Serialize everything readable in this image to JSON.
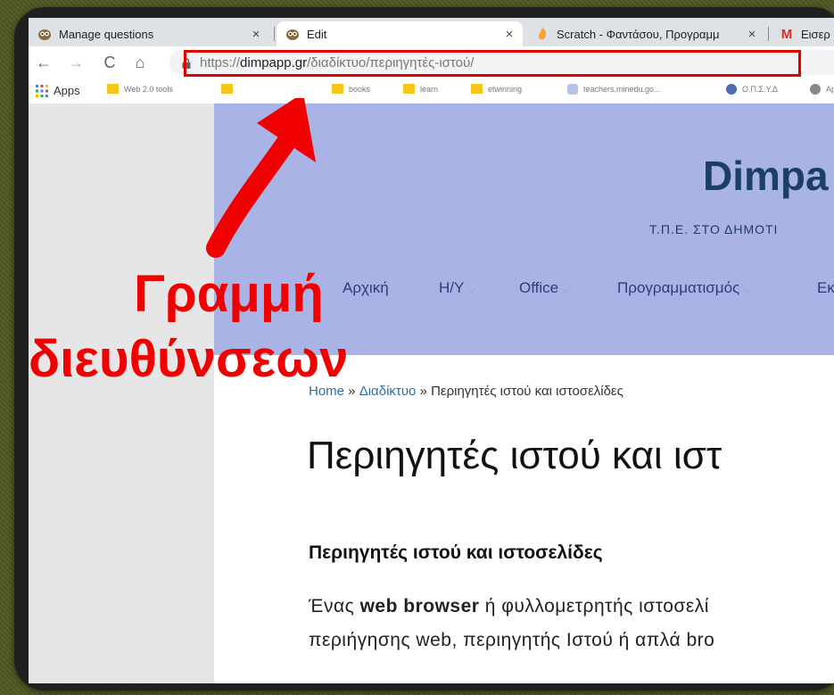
{
  "tabs": [
    {
      "title": "Manage questions",
      "icon": "owl-icon",
      "close": "×"
    },
    {
      "title": "Edit",
      "icon": "owl-icon",
      "close": "×"
    },
    {
      "title": "Scratch - Φαντάσου, Προγραμμ",
      "icon": "scratch-icon",
      "close": "×"
    },
    {
      "title": "Εισερ",
      "icon": "gmail-icon"
    }
  ],
  "toolbar": {
    "back": "←",
    "forward": "→",
    "reload": "C",
    "home": "⌂",
    "url_scheme": "https://",
    "url_domain": "dimpapp.gr",
    "url_path": "/διαδίκτυο/περιηγητές-ιστού/"
  },
  "bookmarks": {
    "apps": "Apps",
    "items": [
      "Web 2.0 tools",
      "books",
      "learn",
      "etwinning",
      "teachers.minedu.go...",
      "Ο.Π.Σ.Υ.Δ",
      "App"
    ]
  },
  "site": {
    "title": "Dimpa",
    "tagline": "Τ.Π.Ε. ΣΤΟ ΔΗΜΟΤΙ",
    "menu": [
      "Αρχική",
      "Η/Υ",
      "Office",
      "Προγραμματισμός",
      "Εκ"
    ],
    "breadcrumb": {
      "home": "Home",
      "sep": " » ",
      "section": "Διαδίκτυο",
      "current": "Περιηγητές ιστού και ιστοσελίδες"
    },
    "heading": "Περιηγητές ιστού και ιστ",
    "subheading": "Περιηγητές ιστού και ιστοσελίδες",
    "para_line1_a": "Ένας ",
    "para_line1_b": "web browser",
    "para_line1_c": " ή φυλλομετρητής ιστοσελί",
    "para_line2": "περιήγησης web, περιηγητής Ιστού ή απλά bro"
  },
  "annotation": {
    "line1": "Γραμμή",
    "line2": "διευθύνσεων",
    "color": "#f00000"
  }
}
